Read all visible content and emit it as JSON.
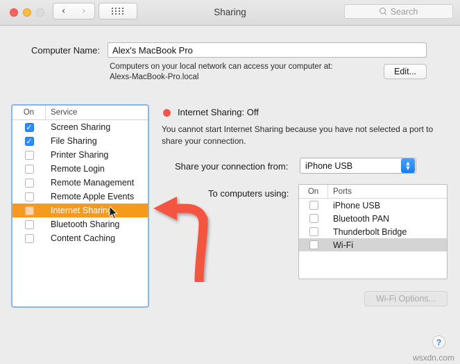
{
  "window": {
    "title": "Sharing",
    "traffic_lights": [
      "close",
      "minimize",
      "zoom"
    ],
    "nav_back_icon": "chevron-left-icon",
    "nav_forward_icon": "chevron-right-icon",
    "grid_icon": "grid-dots-icon"
  },
  "search": {
    "placeholder": "Search",
    "icon": "search-icon"
  },
  "computer_name": {
    "label": "Computer Name:",
    "value": "Alex's MacBook Pro",
    "help_line1": "Computers on your local network can access your computer at:",
    "help_line2": "Alexs-MacBook-Pro.local",
    "edit_button": "Edit..."
  },
  "services": {
    "header": {
      "on": "On",
      "service": "Service"
    },
    "items": [
      {
        "label": "Screen Sharing",
        "checked": true,
        "selected": false
      },
      {
        "label": "File Sharing",
        "checked": true,
        "selected": false
      },
      {
        "label": "Printer Sharing",
        "checked": false,
        "selected": false
      },
      {
        "label": "Remote Login",
        "checked": false,
        "selected": false
      },
      {
        "label": "Remote Management",
        "checked": false,
        "selected": false
      },
      {
        "label": "Remote Apple Events",
        "checked": false,
        "selected": false
      },
      {
        "label": "Internet Sharing",
        "checked": false,
        "selected": true
      },
      {
        "label": "Bluetooth Sharing",
        "checked": false,
        "selected": false
      },
      {
        "label": "Content Caching",
        "checked": false,
        "selected": false
      }
    ]
  },
  "detail": {
    "status_title": "Internet Sharing: Off",
    "status_indicator_color": "#f8534d",
    "status_description": "You cannot start Internet Sharing because you have not selected a port to share your connection.",
    "share_from_label": "Share your connection from:",
    "share_from_value": "iPhone USB",
    "share_from_options": [
      "iPhone USB",
      "Bluetooth PAN",
      "Thunderbolt Bridge",
      "Wi-Fi"
    ],
    "ports_label": "To computers using:",
    "ports_header": {
      "on": "On",
      "ports": "Ports"
    },
    "ports": [
      {
        "label": "iPhone USB",
        "checked": false,
        "selected": false
      },
      {
        "label": "Bluetooth PAN",
        "checked": false,
        "selected": false
      },
      {
        "label": "Thunderbolt Bridge",
        "checked": false,
        "selected": false
      },
      {
        "label": "Wi-Fi",
        "checked": false,
        "selected": true
      }
    ],
    "wifi_options_button": "Wi-Fi Options...",
    "wifi_options_enabled": false
  },
  "annotation": {
    "arrow_icon": "curved-arrow-left-icon",
    "arrow_color": "#f4553f",
    "points_to": "Internet Sharing"
  },
  "footer": {
    "help_button": "?",
    "watermark": "wsxdn.com"
  },
  "colors": {
    "selection_orange": "#f59a1e",
    "checkbox_blue": "#2c8dfb",
    "focus_ring": "#8ab4e8",
    "row_selected_gray": "#d4d4d4"
  }
}
